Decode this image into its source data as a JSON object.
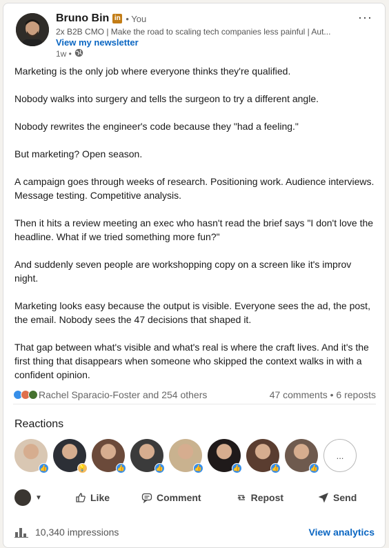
{
  "author": {
    "name": "Bruno Bin",
    "badge": "in",
    "you_label": "• You",
    "headline": "2x B2B CMO | Make the road to scaling tech companies less painful | Aut...",
    "newsletter_link": "View my newsletter",
    "time": "1w •",
    "visibility_icon": "globe-icon"
  },
  "post": {
    "paragraphs": [
      "Marketing is the only job where everyone thinks they're qualified.",
      "Nobody walks into surgery and tells the surgeon to try a different angle.",
      "Nobody rewrites the engineer's code because they \"had a feeling.\"",
      "But marketing? Open season.",
      "A campaign goes through weeks of research. Positioning work. Audience interviews. Message testing. Competitive analysis.",
      "Then it hits a review meeting an exec who hasn't read the brief says \"I don't love the headline. What if we tried something more fun?\"",
      "And suddenly seven people are workshopping copy on a screen like it's improv night.",
      "Marketing looks easy because the output is visible. Everyone sees the ad, the post, the email. Nobody sees the 47 decisions that shaped it.",
      "That gap between what's visible and what's real is where the craft lives. And it's the first thing that disappears when someone who skipped the context walks in with a confident opinion."
    ]
  },
  "social": {
    "reactors_text": "Rachel Sparacio-Foster and 254 others",
    "comments_reposts": "47 comments • 6 reposts"
  },
  "reactions": {
    "title": "Reactions",
    "more_label": "...",
    "items": [
      {
        "type": "like",
        "color": "#d9c7b3"
      },
      {
        "type": "insightful",
        "color": "#2c2f36"
      },
      {
        "type": "like",
        "color": "#6b4a3a"
      },
      {
        "type": "like",
        "color": "#3b3b3b"
      },
      {
        "type": "like",
        "color": "#c9b28f"
      },
      {
        "type": "like",
        "color": "#1f1a1a"
      },
      {
        "type": "like",
        "color": "#5a3d30"
      },
      {
        "type": "like",
        "color": "#6e5a4e"
      }
    ]
  },
  "actions": {
    "like": "Like",
    "comment": "Comment",
    "repost": "Repost",
    "send": "Send"
  },
  "footer": {
    "impressions": "10,340 impressions",
    "analytics_link": "View analytics"
  },
  "colors": {
    "accent": "#0a66c2",
    "like_blue": "#378fe9",
    "insightful_yellow": "#f5bb5c"
  }
}
